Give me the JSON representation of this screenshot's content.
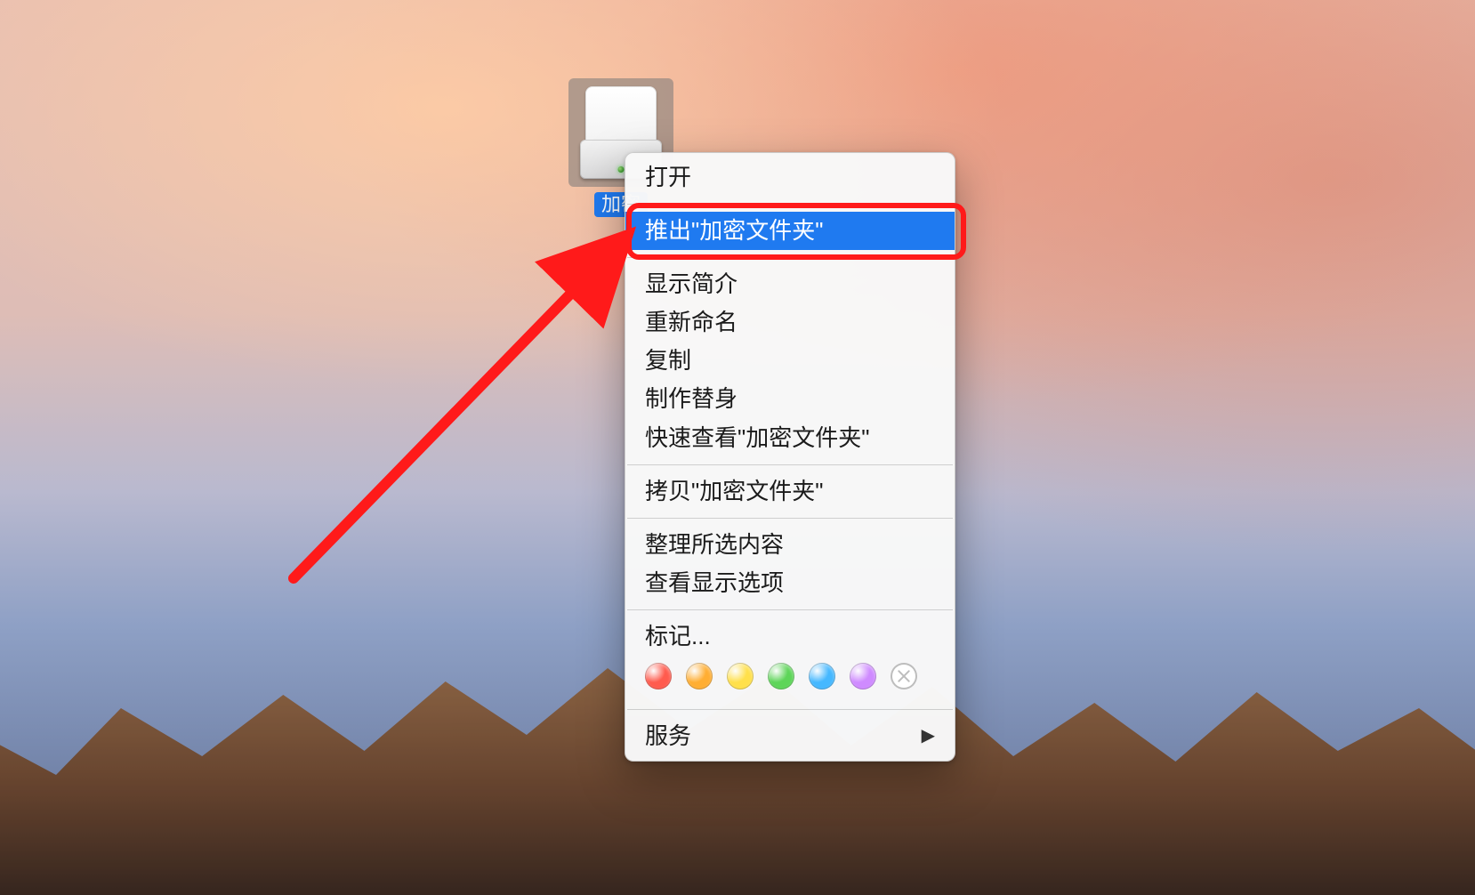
{
  "desktop_icon": {
    "label": "加密",
    "semantic": "mounted-encrypted-volume"
  },
  "context_menu": {
    "items": [
      {
        "id": "open",
        "label": "打开"
      },
      {
        "type": "separator"
      },
      {
        "id": "eject",
        "label": "推出\"加密文件夹\"",
        "selected": true
      },
      {
        "type": "separator"
      },
      {
        "id": "get-info",
        "label": "显示简介"
      },
      {
        "id": "rename",
        "label": "重新命名"
      },
      {
        "id": "duplicate",
        "label": "复制"
      },
      {
        "id": "make-alias",
        "label": "制作替身"
      },
      {
        "id": "quick-look",
        "label": "快速查看\"加密文件夹\""
      },
      {
        "type": "separator"
      },
      {
        "id": "copy",
        "label": "拷贝\"加密文件夹\""
      },
      {
        "type": "separator"
      },
      {
        "id": "clean-up",
        "label": "整理所选内容"
      },
      {
        "id": "view-options",
        "label": "查看显示选项"
      },
      {
        "type": "separator"
      },
      {
        "id": "tags-header",
        "label": "标记..."
      }
    ],
    "tag_colors": [
      "#ff5b4e",
      "#ffae33",
      "#ffe04b",
      "#5ed559",
      "#46b8ff",
      "#cf8bff"
    ],
    "services": {
      "label": "服务",
      "has_submenu": true
    }
  },
  "annotation": {
    "highlight_target": "eject",
    "arrow_from": "bottom-left",
    "color": "#ff1a1a"
  }
}
